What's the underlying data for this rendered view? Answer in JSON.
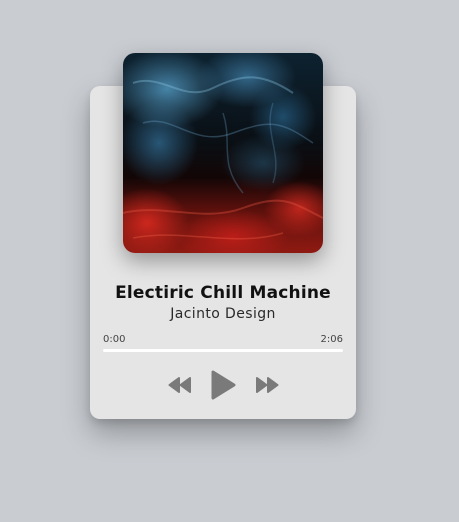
{
  "track": {
    "title": "Electiric Chill Machine",
    "artist": "Jacinto Design"
  },
  "progress": {
    "elapsed": "0:00",
    "total": "2:06",
    "fraction": 0
  },
  "controls": {
    "rewind_icon": "rewind-icon",
    "play_icon": "play-icon",
    "forward_icon": "fast-forward-icon"
  },
  "colors": {
    "background": "#c9cdd2",
    "card": "#e5e5e5",
    "icon": "#7a7a7a",
    "title": "#111111"
  }
}
